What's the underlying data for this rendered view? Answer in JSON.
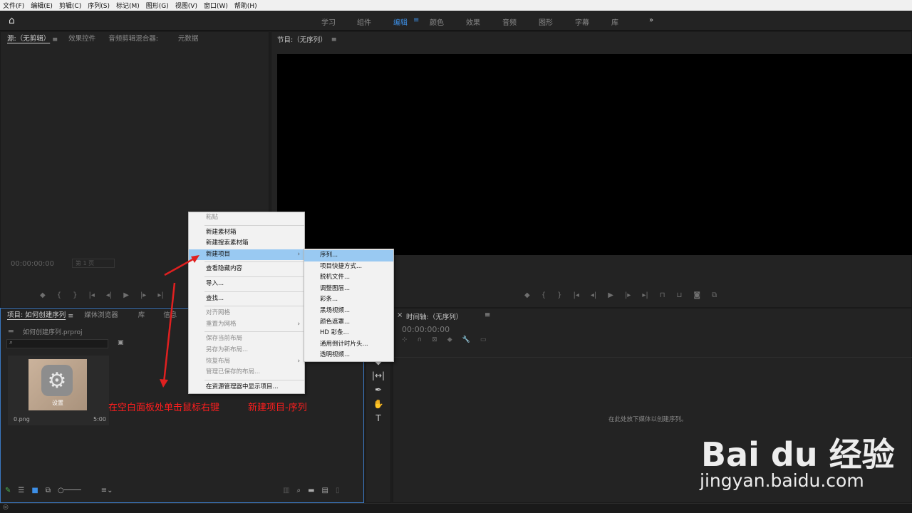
{
  "menubar": [
    "文件(F)",
    "编辑(E)",
    "剪辑(C)",
    "序列(S)",
    "标记(M)",
    "图形(G)",
    "视图(V)",
    "窗口(W)",
    "帮助(H)"
  ],
  "workspaces": {
    "learn": "学习",
    "assembly": "组件",
    "editing": "编辑",
    "color": "颜色",
    "effects": "效果",
    "audio": "音频",
    "graphics": "图形",
    "captions": "字幕",
    "libraries": "库",
    "more": "»"
  },
  "source_panel": {
    "tab_source": "源:（无剪辑）",
    "tab_effects": "效果控件",
    "tab_mixer": "音频剪辑混合器:",
    "tab_meta": "元数据",
    "timecode": "00:00:00:00",
    "zoom": "第 1 页"
  },
  "program_panel": {
    "title": "节目:（无序列）"
  },
  "project_panel": {
    "tab_project": "项目: 如何创建序列",
    "tab_media": "媒体浏览器",
    "tab_libs": "库",
    "tab_info": "信息",
    "file": "如何创建序列.prproj",
    "search_placeholder": "",
    "item_name": "0.png",
    "item_dur": "5:00",
    "thumb_label": "设置"
  },
  "timeline_panel": {
    "title": "时间轴:（无序列）",
    "timecode": "00:00:00:00",
    "empty_hint": "在此处放下媒体以创建序列。"
  },
  "context_menu": {
    "paste": "粘贴",
    "new_bin": "新建素材箱",
    "new_search_bin": "新建搜索素材箱",
    "new_item": "新建项目",
    "view_hidden": "查看隐藏内容",
    "import": "导入...",
    "find": "查找...",
    "align_grid": "对齐网格",
    "reset_grid": "重置为网格",
    "save_layout": "保存当前布局",
    "save_new_layout": "另存为新布局...",
    "restore_layout": "恢复布局",
    "manage_layouts": "管理已保存的布局...",
    "reveal": "在资源管理器中显示项目..."
  },
  "submenu": [
    "序列...",
    "项目快捷方式...",
    "脱机文件...",
    "调整图层...",
    "彩条...",
    "黑场视频...",
    "颜色遮罩...",
    "HD 彩条...",
    "通用倒计时片头...",
    "透明视频..."
  ],
  "annotation": {
    "step1": "在空白面板处单击鼠标右键",
    "step2": "新建项目-序列"
  },
  "watermark": {
    "logo": "Bai du 经验",
    "url": "jingyan.baidu.com"
  },
  "colors": {
    "accent": "#3d8fe6",
    "annotation": "#ff1e1e",
    "menu_highlight": "#99c9f2"
  }
}
